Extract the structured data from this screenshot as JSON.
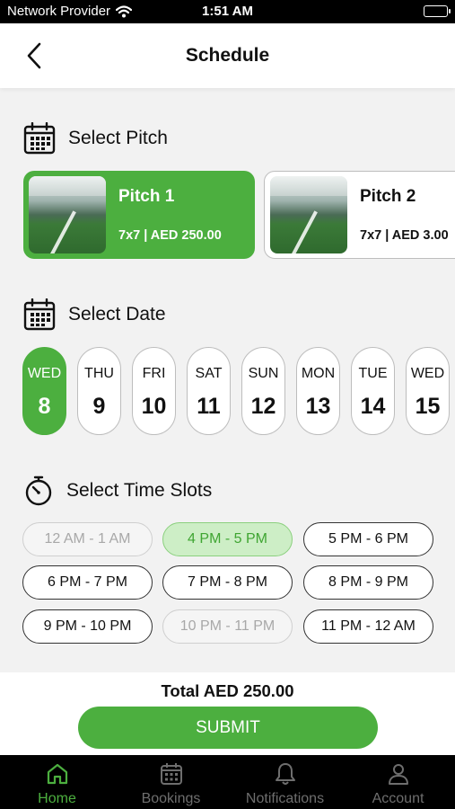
{
  "status_bar": {
    "carrier": "Network Provider",
    "time": "1:51 AM"
  },
  "header": {
    "title": "Schedule",
    "back_icon": "chevron-left-icon"
  },
  "pitch_section": {
    "title": "Select Pitch",
    "icon": "calendar-icon",
    "pitches": [
      {
        "name": "Pitch 1",
        "meta": "7x7 | AED 250.00",
        "selected": true
      },
      {
        "name": "Pitch 2",
        "meta": "7x7 | AED 3.00",
        "selected": false
      }
    ]
  },
  "date_section": {
    "title": "Select Date",
    "icon": "calendar-icon",
    "dates": [
      {
        "day": "WED",
        "num": "8",
        "selected": true
      },
      {
        "day": "THU",
        "num": "9"
      },
      {
        "day": "FRI",
        "num": "10"
      },
      {
        "day": "SAT",
        "num": "11"
      },
      {
        "day": "SUN",
        "num": "12"
      },
      {
        "day": "MON",
        "num": "13"
      },
      {
        "day": "TUE",
        "num": "14"
      },
      {
        "day": "WED",
        "num": "15"
      }
    ]
  },
  "time_section": {
    "title": "Select Time Slots",
    "icon": "stopwatch-icon",
    "slots": [
      {
        "label": "12 AM - 1 AM",
        "state": "disabled"
      },
      {
        "label": "4 PM - 5 PM",
        "state": "selected"
      },
      {
        "label": "5 PM - 6 PM",
        "state": "available"
      },
      {
        "label": "6 PM - 7 PM",
        "state": "available"
      },
      {
        "label": "7 PM - 8 PM",
        "state": "available"
      },
      {
        "label": "8 PM - 9 PM",
        "state": "available"
      },
      {
        "label": "9 PM - 10 PM",
        "state": "available"
      },
      {
        "label": "10 PM - 11 PM",
        "state": "disabled"
      },
      {
        "label": "11 PM - 12 AM",
        "state": "available"
      }
    ]
  },
  "footer": {
    "total": "Total AED 250.00",
    "submit_label": "SUBMIT"
  },
  "tabbar": {
    "tabs": [
      {
        "label": "Home",
        "icon": "home-icon",
        "active": true
      },
      {
        "label": "Bookings",
        "icon": "calendar-icon"
      },
      {
        "label": "Notifications",
        "icon": "bell-icon"
      },
      {
        "label": "Account",
        "icon": "user-icon"
      }
    ]
  },
  "colors": {
    "accent": "#4caf3f",
    "slot_selected_bg": "#cdeec6",
    "tabbar_bg": "#000000"
  }
}
